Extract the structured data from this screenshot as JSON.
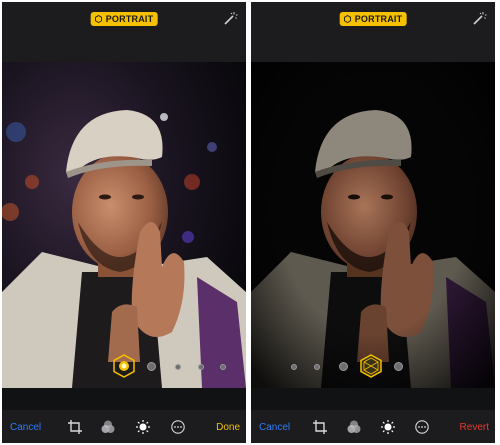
{
  "colors": {
    "accent_yellow": "#f4c000",
    "cancel_blue": "#2f7cf6",
    "revert_red": "#e53a2e",
    "bar_dark": "#1c1c1e"
  },
  "left": {
    "badge_label": "PORTRAIT",
    "cancel_label": "Cancel",
    "action_label": "Done",
    "icons": [
      "crop-icon",
      "filters-icon",
      "adjust-icon",
      "more-icon"
    ],
    "lighting_selected": "natural-light"
  },
  "right": {
    "badge_label": "PORTRAIT",
    "cancel_label": "Cancel",
    "action_label": "Revert",
    "icons": [
      "crop-icon",
      "filters-icon",
      "adjust-icon",
      "more-icon"
    ],
    "lighting_selected": "stage-light"
  }
}
